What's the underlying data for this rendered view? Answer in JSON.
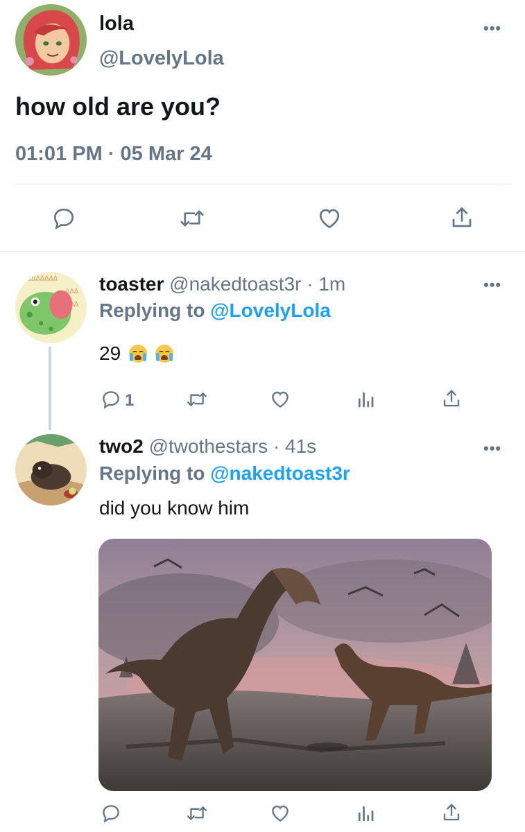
{
  "main_tweet": {
    "name": "lola",
    "handle": "@LovelyLola",
    "text": "how old are you?",
    "timestamp": "01:01 PM · 05 Mar 24",
    "more": "•••"
  },
  "reply1": {
    "name": "toaster",
    "handle": "@nakedtoast3r · 1m",
    "replying_prefix": "Replying to",
    "replying_to": "@LovelyLola",
    "text": "29",
    "reply_count": "1",
    "more": "•••"
  },
  "reply2": {
    "name": "two2",
    "handle": "@twothestars · 41s",
    "replying_prefix": "Replying to",
    "replying_to": "@nakedtoast3r",
    "text": "did you know him",
    "more": "•••"
  },
  "colors": {
    "accent": "#1da1f2",
    "secondary_text": "#657786",
    "icon": "#657786",
    "divider": "#e1e8ed"
  }
}
